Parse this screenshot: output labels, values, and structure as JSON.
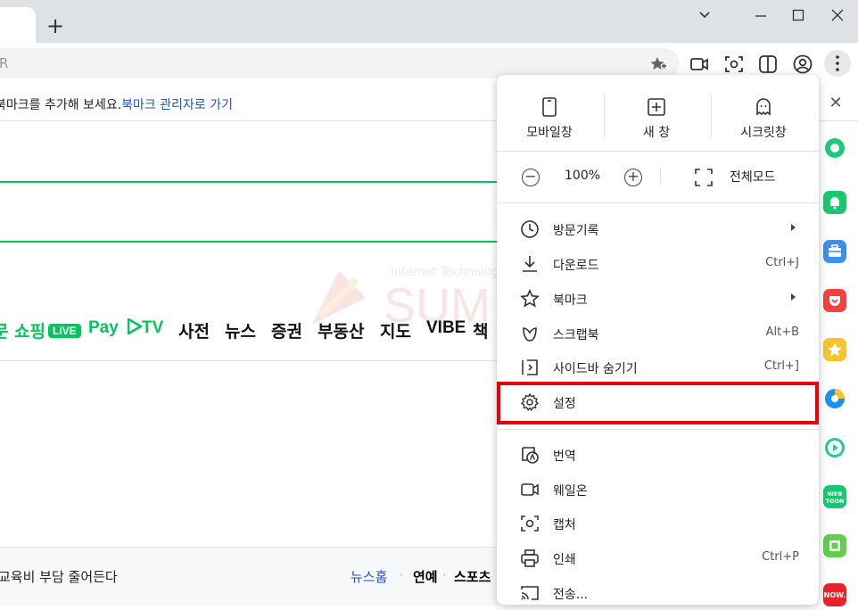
{
  "browser": {
    "new_tab_symbol": "+",
    "window_controls": {
      "dropdown": "⌄",
      "minimize": "—",
      "maximize": "☐",
      "close": "✕"
    },
    "omnibox_text": "R"
  },
  "bookmark_bar": {
    "text": "북마크를 추가해 보세요.",
    "link": "북마크 관리자로 가기",
    "close_symbol": "✕"
  },
  "page": {
    "nav": [
      "쇼핑",
      "Pay",
      "TV",
      "사전",
      "뉴스",
      "증권",
      "부동산",
      "지도",
      "VIBE",
      "책"
    ],
    "nav_prefix": "문",
    "live_badge": "LIVE",
    "headline": "교육비 부담 줄어든다",
    "news_tabs": [
      "뉴스홈",
      "연예",
      "스포츠"
    ],
    "news_dot": "·",
    "watermark_small": "Internet Technology",
    "watermark_big": "SUM"
  },
  "menu": {
    "top_buttons": [
      "모바일창",
      "새 창",
      "시크릿창"
    ],
    "zoom_minus": "−",
    "zoom_plus": "+",
    "zoom_value": "100%",
    "fullscreen_label": "전체모드",
    "items": [
      {
        "label": "방문기록",
        "shortcut": "",
        "submenu": true
      },
      {
        "label": "다운로드",
        "shortcut": "Ctrl+J",
        "submenu": false
      },
      {
        "label": "북마크",
        "shortcut": "",
        "submenu": true
      },
      {
        "label": "스크랩북",
        "shortcut": "Alt+B",
        "submenu": false
      },
      {
        "label": "사이드바 숨기기",
        "shortcut": "Ctrl+]",
        "submenu": false
      },
      {
        "label": "설정",
        "shortcut": "",
        "submenu": false
      },
      {
        "label": "번역",
        "shortcut": "",
        "submenu": false
      },
      {
        "label": "웨일온",
        "shortcut": "",
        "submenu": false
      },
      {
        "label": "캡처",
        "shortcut": "",
        "submenu": false
      },
      {
        "label": "인쇄",
        "shortcut": "Ctrl+P",
        "submenu": false
      },
      {
        "label": "전송...",
        "shortcut": "",
        "submenu": false
      }
    ]
  },
  "sidebar": {
    "webtoon_label": "WEB TOON",
    "now_label": "NOW."
  },
  "colors": {
    "accent_green": "#03c75a",
    "highlight_red": "#e8000b",
    "link_blue": "#1a56c4"
  }
}
